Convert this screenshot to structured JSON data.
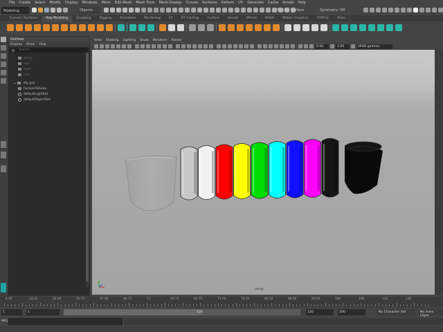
{
  "menubar": {
    "items": [
      "File",
      "Create",
      "Select",
      "Modify",
      "Display",
      "Windows",
      "Mesh",
      "Edit Mesh",
      "Mesh Tools",
      "Mesh Display",
      "Curves",
      "Surfaces",
      "Deform",
      "UV",
      "Generate",
      "Cache",
      "Arnold",
      "Help"
    ]
  },
  "statusline": {
    "mode": "Modeling",
    "selection_mode": "Objects",
    "live_surface": "No Live Surface",
    "symmetry": "Symmetry: Off"
  },
  "shelf": {
    "tabs": [
      "Curves / Surfaces",
      "Poly Modeling",
      "Sculpting",
      "Rigging",
      "Animation",
      "Rendering",
      "FX",
      "FX Caching",
      "Custom",
      "Arnold",
      "Bifrost",
      "MASH",
      "Motion Graphics",
      "TURTLE",
      "XGen"
    ],
    "active_tab": "Poly Modeling"
  },
  "outliner": {
    "title": "Outliner",
    "menu": [
      "Display",
      "Show",
      "Help"
    ],
    "search_placeholder": "Search...",
    "items": [
      {
        "label": "persp",
        "dim": true,
        "kind": "camera"
      },
      {
        "label": "top",
        "dim": true,
        "kind": "camera"
      },
      {
        "label": "front",
        "dim": true,
        "kind": "camera"
      },
      {
        "label": "side",
        "dim": true,
        "kind": "camera"
      },
      {
        "label": "obj_grp",
        "dim": false,
        "kind": "group"
      },
      {
        "label": "horizontStudio",
        "dim": false,
        "kind": "mesh"
      },
      {
        "label": "defaultLightSet",
        "dim": false,
        "kind": "set"
      },
      {
        "label": "defaultObjectSet",
        "dim": false,
        "kind": "set"
      }
    ]
  },
  "viewport": {
    "menu": [
      "View",
      "Shading",
      "Lighting",
      "Show",
      "Renderer",
      "Panels"
    ],
    "exposure": "0.00",
    "gamma": "1.00",
    "color_space": "sRGB gamma",
    "camera_label": "persp",
    "ring_colors": [
      "#c8c8c8",
      "#f2f2f2",
      "#ff0000",
      "#ffff00",
      "#00dd00",
      "#00ffff",
      "#1010ff",
      "#ff00ff",
      "#151515"
    ]
  },
  "timeslider": {
    "ticks": [
      "5",
      "10",
      "15",
      "20",
      "25",
      "30",
      "35",
      "40",
      "45",
      "50",
      "55",
      "60",
      "65",
      "70",
      "75",
      "80",
      "85",
      "90",
      "95",
      "100",
      "105",
      "110",
      "115",
      "120"
    ],
    "labels": [
      "4.25",
      "13.25",
      "22.50",
      "31.75",
      "37.50",
      "46.75",
      "51",
      "58.75",
      "64.75",
      "71.50",
      "76.25",
      "82.50",
      "88.00",
      "94.50",
      "100",
      "106",
      "112",
      "120"
    ]
  },
  "rangeslider": {
    "start": "1",
    "playback_start": "1",
    "playback_end": "120",
    "end": "120",
    "max": "200",
    "character_set": "No Character Set",
    "anim_layer": "No Anim Layer",
    "bar_value": "120"
  },
  "cmdline": {
    "label": "MEL"
  }
}
